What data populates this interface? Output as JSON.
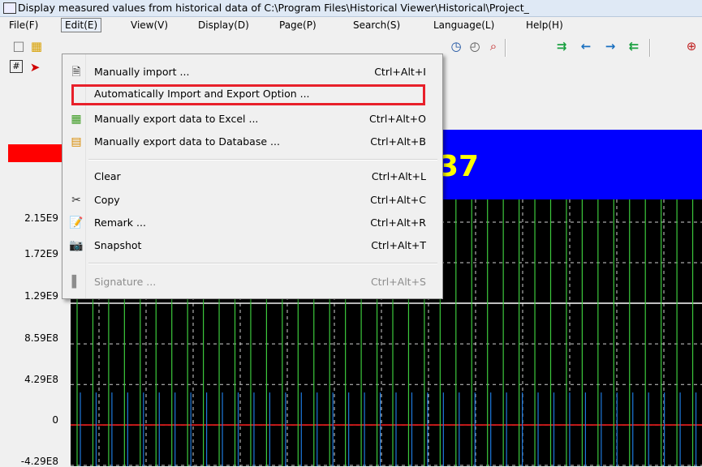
{
  "window": {
    "title": "Display measured values from historical data of C:\\Program Files\\Historical Viewer\\Historical\\Project_"
  },
  "menubar": {
    "items": [
      {
        "label": "File(F)"
      },
      {
        "label": "Edit(E)"
      },
      {
        "label": "View(V)"
      },
      {
        "label": "Display(D)"
      },
      {
        "label": "Page(P)"
      },
      {
        "label": "Search(S)"
      },
      {
        "label": "Language(L)"
      },
      {
        "label": "Help(H)"
      }
    ]
  },
  "edit_menu": {
    "items": [
      {
        "label": "Manually import ...",
        "shortcut": "Ctrl+Alt+I",
        "icon": "import-icon"
      },
      {
        "label": "Automatically Import and Export Option ...",
        "shortcut": "",
        "icon": ""
      },
      {
        "label": "Manually export data to Excel ...",
        "shortcut": "Ctrl+Alt+O",
        "icon": "excel-export-icon"
      },
      {
        "label": "Manually export data to Database ...",
        "shortcut": "Ctrl+Alt+B",
        "icon": "database-export-icon"
      },
      {
        "label": "Clear",
        "shortcut": "Ctrl+Alt+L",
        "icon": ""
      },
      {
        "label": "Copy",
        "shortcut": "Ctrl+Alt+C",
        "icon": "scissors-icon"
      },
      {
        "label": "Remark ...",
        "shortcut": "Ctrl+Alt+R",
        "icon": "remark-icon"
      },
      {
        "label": "Snapshot",
        "shortcut": "Ctrl+Alt+T",
        "icon": "camera-icon"
      },
      {
        "label": "Signature ...",
        "shortcut": "Ctrl+Alt+S",
        "icon": "signature-icon",
        "disabled": true
      }
    ]
  },
  "display": {
    "value_fragment": "37",
    "banner_color": "#0000ff",
    "value_color": "#ffff00",
    "indicator_color": "#ff0000"
  },
  "chart_data": {
    "type": "line",
    "ytick_labels": [
      "2.15E9",
      "1.72E9",
      "1.29E9",
      "8.59E8",
      "4.29E8",
      "0",
      "-4.29E8"
    ],
    "yticks": [
      2150000000,
      1720000000,
      1290000000,
      859000000,
      429000000,
      0,
      -429000000
    ],
    "grid": true,
    "background": "#000000",
    "series_colors": [
      "#3cc83c",
      "#1e78dc"
    ],
    "reference_lines": [
      {
        "value": 1290000000,
        "color": "#ffffff"
      },
      {
        "value": 0,
        "color": "#ff2020"
      }
    ],
    "transitions": 40
  }
}
